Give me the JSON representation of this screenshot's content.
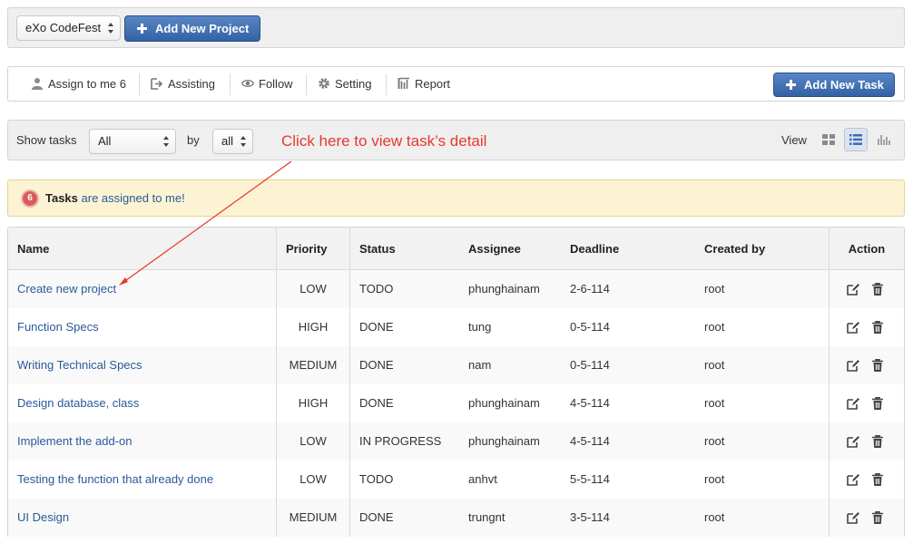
{
  "project": {
    "selected": "eXo CodeFest",
    "add_button": "Add New Project"
  },
  "toolbar": {
    "assign_to_me": "Assign to me 6",
    "assisting": "Assisting",
    "follow": "Follow",
    "setting": "Setting",
    "report": "Report",
    "add_task": "Add New Task"
  },
  "filter": {
    "show_tasks_label": "Show tasks",
    "show_tasks_value": "All",
    "by_label": "by",
    "by_value": "all",
    "annotation": "Click here to view task’s detail",
    "view_label": "View",
    "views": [
      "grid-view-icon",
      "list-view-icon",
      "chart-view-icon"
    ],
    "active_view": "list"
  },
  "alert": {
    "count": "6",
    "bold": "Tasks",
    "text": "are assigned to me!"
  },
  "table": {
    "columns": [
      "Name",
      "Priority",
      "Status",
      "Assignee",
      "Deadline",
      "Created by",
      "Action"
    ],
    "rows": [
      {
        "name": "Create new project",
        "priority": "LOW",
        "status": "TODO",
        "assignee": "phunghainam",
        "deadline": "2-6-114",
        "created_by": "root"
      },
      {
        "name": "Function Specs",
        "priority": "HIGH",
        "status": "DONE",
        "assignee": "tung",
        "deadline": "0-5-114",
        "created_by": "root"
      },
      {
        "name": "Writing Technical Specs",
        "priority": "MEDIUM",
        "status": "DONE",
        "assignee": "nam",
        "deadline": "0-5-114",
        "created_by": "root"
      },
      {
        "name": "Design database, class",
        "priority": "HIGH",
        "status": "DONE",
        "assignee": "phunghainam",
        "deadline": "4-5-114",
        "created_by": "root"
      },
      {
        "name": "Implement the add-on",
        "priority": "LOW",
        "status": "IN PROGRESS",
        "assignee": "phunghainam",
        "deadline": "4-5-114",
        "created_by": "root"
      },
      {
        "name": "Testing the function that already done",
        "priority": "LOW",
        "status": "TODO",
        "assignee": "anhvt",
        "deadline": "5-5-114",
        "created_by": "root"
      },
      {
        "name": "UI Design",
        "priority": "MEDIUM",
        "status": "DONE",
        "assignee": "trungnt",
        "deadline": "3-5-114",
        "created_by": "root"
      }
    ]
  },
  "colors": {
    "primary": "#3362a5",
    "link": "#2a5a9a",
    "annotation": "#e8382b",
    "alert_bg": "#fcf3d4"
  }
}
